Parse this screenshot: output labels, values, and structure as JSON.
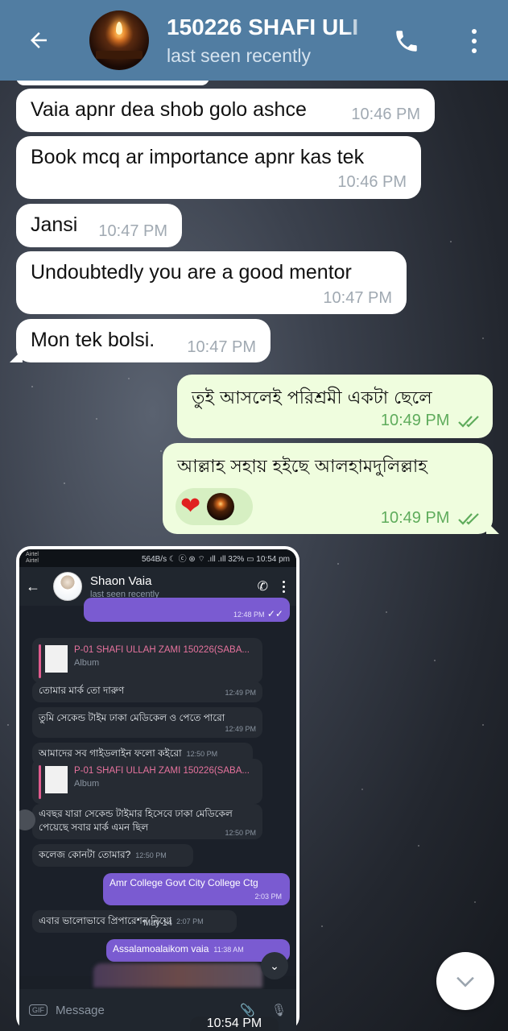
{
  "header": {
    "name": "150226 SHAFI ULI",
    "status": "last seen recently",
    "icons": {
      "back": "arrow-left-icon",
      "call": "phone-icon",
      "menu": "more-vertical-icon"
    },
    "bg_color": "#517da2"
  },
  "messages": [
    {
      "dir": "in",
      "text": "Vaia apnr dea shob golo ashce",
      "time": "10:46 PM"
    },
    {
      "dir": "in",
      "text": "Book mcq ar importance apnr kas tek",
      "time": "10:46 PM"
    },
    {
      "dir": "in",
      "text": "Jansi",
      "time": "10:47 PM"
    },
    {
      "dir": "in",
      "text": "Undoubtedly you are a good mentor",
      "time": "10:47 PM"
    },
    {
      "dir": "in",
      "text": "Mon tek bolsi.",
      "time": "10:47 PM"
    },
    {
      "dir": "out",
      "text": "তুই আসলেই পরিশ্রমী একটা ছেলে",
      "time": "10:49 PM",
      "read": true
    },
    {
      "dir": "out",
      "text": "আল্লাহ সহায় হইছে আলহামদুলিল্লাহ",
      "time": "10:49 PM",
      "read": true,
      "reactions": [
        "heart",
        "avatar"
      ]
    }
  ],
  "screenshot": {
    "status_bar": {
      "carrier": "Airtel Airtel",
      "info": "564B/s ☾ ⓒ ⊛ ⌔ .ıll .ıll 32% ▭ 10:54 pm"
    },
    "header": {
      "name": "Shaon Vaia",
      "status": "last seen recently"
    },
    "top_out_time": "12:48 PM",
    "file1": {
      "name": "P-01 SHAFI ULLAH ZAMI 150226(SABA...",
      "sub": "Album"
    },
    "msgs": [
      {
        "dir": "in",
        "text": "তোমার মার্ক তো দারুণ",
        "time": "12:49 PM"
      },
      {
        "dir": "in",
        "text": "তুমি সেকেন্ড টাইম ঢাকা মেডিকেল ও পেতে পারো",
        "time": "12:49 PM"
      },
      {
        "dir": "in",
        "text": "আমাদের সব গাইডলাইন ফলো কইরো",
        "time": "12:50 PM"
      },
      {
        "dir": "in",
        "text": "এবছর যারা সেকেন্ড টাইমার হিসেবে ঢাকা মেডিকেল পেয়েছে সবার মার্ক এমন ছিল",
        "time": "12:50 PM"
      },
      {
        "dir": "in",
        "text": "কলেজ কোনটা তোমার?",
        "time": "12:50 PM"
      },
      {
        "dir": "out",
        "text": "Amr College Govt City College Ctg",
        "time": "2:03 PM"
      },
      {
        "dir": "in",
        "text": "এবার ভালোভাবে প্রিপারেশন নিয়ো",
        "time": "2:07 PM"
      },
      {
        "dir": "out",
        "text": "Assalamoalaikom vaia",
        "time": "11:38 AM"
      }
    ],
    "file2": {
      "name": "P-01 SHAFI ULLAH ZAMI 150226(SABA...",
      "sub": "Album"
    },
    "date_divider": "May 14",
    "input_placeholder": "Message",
    "gif_label": "GIF",
    "bottom_time": "10:54 PM"
  },
  "colors": {
    "incoming": "#ffffff",
    "outgoing": "#effdde",
    "out_time": "#5fac5c"
  }
}
